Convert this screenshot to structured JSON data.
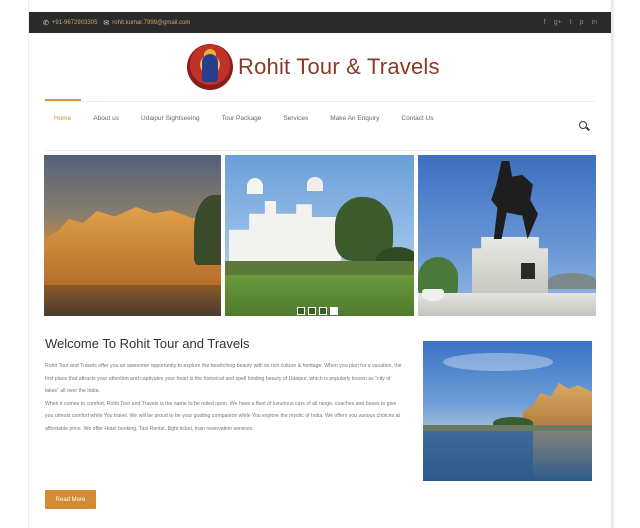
{
  "topbar": {
    "phone": "+91-9672903305",
    "email": "rohit.kumar.7999@gmail.com",
    "social_icons": [
      "facebook-icon",
      "google-plus-icon",
      "twitter-icon",
      "pinterest-icon",
      "linkedin-icon"
    ]
  },
  "brand": {
    "name": "Rohit Tour & Travels"
  },
  "nav": {
    "items": [
      {
        "label": "Home",
        "active": true
      },
      {
        "label": "About us"
      },
      {
        "label": "Udaipur Sightseeing"
      },
      {
        "label": "Tour Package"
      },
      {
        "label": "Services"
      },
      {
        "label": "Make An Enquiry"
      },
      {
        "label": "Contact Us"
      }
    ]
  },
  "slider": {
    "slides": [
      "Udaipur city palace at sunset",
      "Monsoon Palace",
      "Maharana Pratap statue"
    ],
    "dot_count": 4,
    "active_dot": 4
  },
  "welcome": {
    "title": "Welcome To Rohit Tour and Travels",
    "paragraph1": "Rohit Tour and Travels offer you an awesome opportunity to explore the bewitching beauty with its rich culture & heritage. When you plan for a vacation, the first place that attracts your attention and captivates your heart is the historical and spell binding beauty of Udaipur, which is popularly known as \"city of lakes\" all over the India.",
    "paragraph2": "When it comes to comfort, Rohit Tour and Travels is the name to be relied upon. We have a fleet of luxurious cars of all range, coaches and buses to give you utmost comfort while You travel. We will be proud to be your guiding companion while You explore the mystic of India. We offers you various choices at affordable price. We offer Hotel booking, Taxi Rental, flight ticket, train reservation services.",
    "button": "Read More"
  },
  "colors": {
    "accent": "#d28a34",
    "brand_text": "#8b3a25",
    "topbar_bg": "#2b2b2b"
  }
}
